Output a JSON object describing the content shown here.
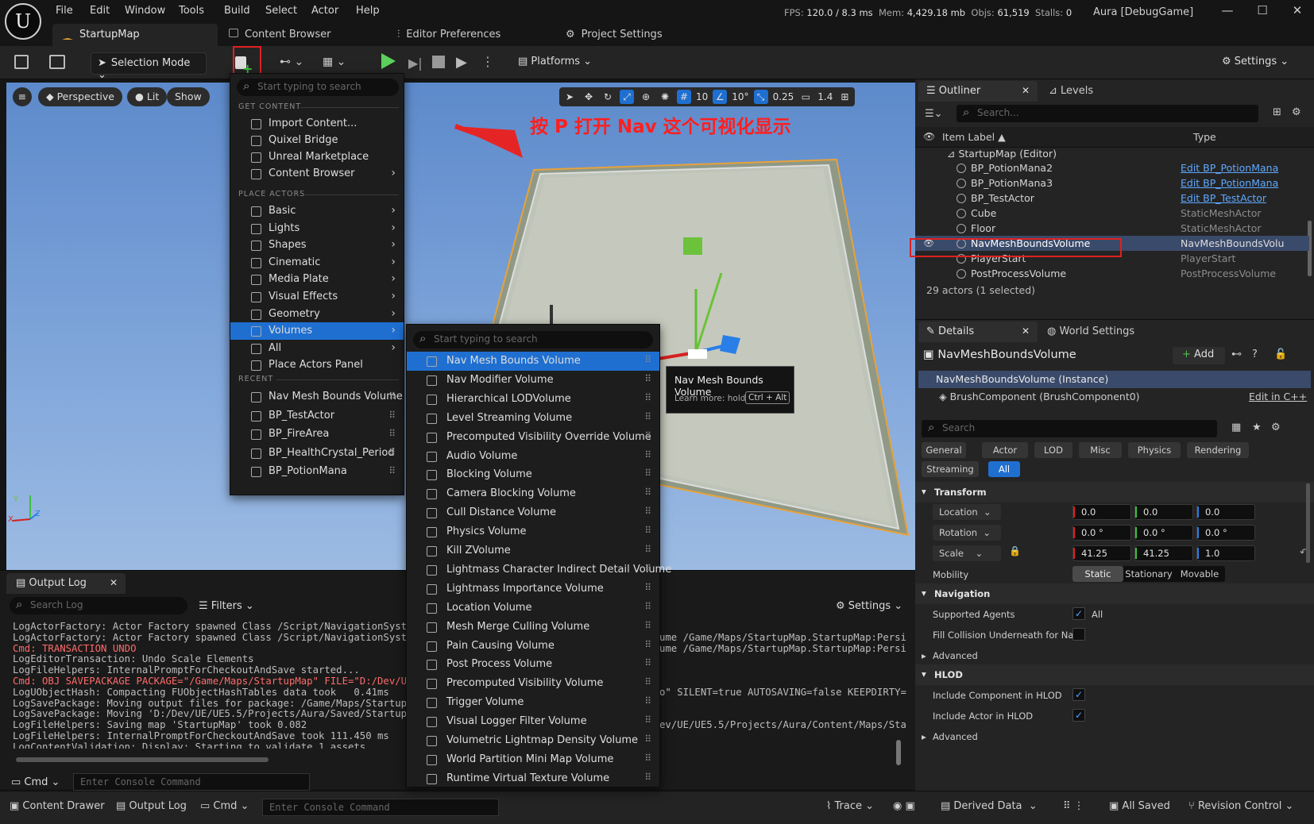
{
  "app": {
    "logo": "U",
    "menus": [
      "File",
      "Edit",
      "Window",
      "Tools",
      "Build",
      "Select",
      "Actor",
      "Help"
    ],
    "stats": {
      "fps_label": "FPS:",
      "fps": "120.0",
      "ms": "/ 8.3 ms",
      "mem_label": "Mem:",
      "mem": "4,429.18 mb",
      "objs_label": "Objs:",
      "objs": "61,519",
      "stalls_label": "Stalls:",
      "stalls": "0"
    },
    "project": "Aura [DebugGame]",
    "window_buttons": [
      "—",
      "☐",
      "✕"
    ]
  },
  "tabs": {
    "active": "StartupMap",
    "others": [
      "Content Browser",
      "Editor Preferences",
      "Project Settings"
    ]
  },
  "toolbar": {
    "selection_mode": "Selection Mode",
    "platforms": "Platforms",
    "settings": "Settings"
  },
  "viewport": {
    "buttons": [
      "Perspective",
      "Lit",
      "Show"
    ],
    "grid_value": "10",
    "angle_value": "10°",
    "scale_value": "0.25",
    "camera_speed": "1.4",
    "annotation": "按 P 打开 Nav 这个可视化显示",
    "axis_labels": {
      "x": "X",
      "y": "Y",
      "z": "Z"
    }
  },
  "place_menu": {
    "search_placeholder": "Start typing to search",
    "get_content_header": "GET CONTENT",
    "get_content": [
      "Import Content...",
      "Quixel Bridge",
      "Unreal Marketplace",
      "Content Browser"
    ],
    "place_actors_header": "PLACE ACTORS",
    "place_actors": [
      "Basic",
      "Lights",
      "Shapes",
      "Cinematic",
      "Media Plate",
      "Visual Effects",
      "Geometry",
      "Volumes",
      "All",
      "Place Actors Panel"
    ],
    "recent_header": "RECENT",
    "recent": [
      "Nav Mesh Bounds Volume",
      "BP_TestActor",
      "BP_FireArea",
      "BP_HealthCrystal_Period",
      "BP_PotionMana"
    ]
  },
  "volumes_menu": {
    "search_placeholder": "Start typing to search",
    "items": [
      "Nav Mesh Bounds Volume",
      "Nav Modifier Volume",
      "Hierarchical LODVolume",
      "Level Streaming Volume",
      "Precomputed Visibility Override Volume",
      "Audio Volume",
      "Blocking Volume",
      "Camera Blocking Volume",
      "Cull Distance Volume",
      "Physics Volume",
      "Kill ZVolume",
      "Lightmass Character Indirect Detail Volume",
      "Lightmass Importance Volume",
      "Location Volume",
      "Mesh Merge Culling Volume",
      "Pain Causing Volume",
      "Post Process Volume",
      "Precomputed Visibility Volume",
      "Trigger Volume",
      "Visual Logger Filter Volume",
      "Volumetric Lightmap Density Volume",
      "World Partition Mini Map Volume",
      "Runtime Virtual Texture Volume"
    ]
  },
  "tooltip": {
    "title": "Nav Mesh Bounds Volume",
    "learn": "Learn more: hold",
    "keys": "Ctrl + Alt"
  },
  "outliner": {
    "tab": "Outliner",
    "tab2": "Levels",
    "search_placeholder": "Search...",
    "col_label": "Item Label ▲",
    "col_type": "Type",
    "root": "StartupMap (Editor)",
    "rows": [
      {
        "label": "BP_PotionMana2",
        "type": "Edit BP_PotionMana",
        "link": true
      },
      {
        "label": "BP_PotionMana3",
        "type": "Edit BP_PotionMana",
        "link": true
      },
      {
        "label": "BP_TestActor",
        "type": "Edit BP_TestActor",
        "link": true
      },
      {
        "label": "Cube",
        "type": "StaticMeshActor",
        "link": false
      },
      {
        "label": "Floor",
        "type": "StaticMeshActor",
        "link": false
      },
      {
        "label": "NavMeshBoundsVolume",
        "type": "NavMeshBoundsVolu",
        "link": false
      },
      {
        "label": "PlayerStart",
        "type": "PlayerStart",
        "link": false
      },
      {
        "label": "PostProcessVolume",
        "type": "PostProcessVolume",
        "link": false
      }
    ],
    "count": "29 actors (1 selected)"
  },
  "details": {
    "tab": "Details",
    "tab2": "World Settings",
    "title": "NavMeshBoundsVolume",
    "add": "Add",
    "instance": "NavMeshBoundsVolume (Instance)",
    "component": "BrushComponent (BrushComponent0)",
    "edit_cpp": "Edit in C++",
    "search_placeholder": "Search",
    "filters": [
      "General",
      "Actor",
      "LOD",
      "Misc",
      "Physics",
      "Rendering",
      "Streaming",
      "All"
    ],
    "transform": {
      "header": "Transform",
      "location_label": "Location",
      "location": [
        "0.0",
        "0.0",
        "0.0"
      ],
      "rotation_label": "Rotation",
      "rotation": [
        "0.0 °",
        "0.0 °",
        "0.0 °"
      ],
      "scale_label": "Scale",
      "scale": [
        "41.25",
        "41.25",
        "1.0"
      ],
      "mobility_label": "Mobility",
      "mobility": [
        "Static",
        "Stationary",
        "Movable"
      ]
    },
    "navigation": {
      "header": "Navigation",
      "supported_agents": "Supported Agents",
      "all": "All",
      "fill_collision": "Fill Collision Underneath for Na...",
      "advanced": "Advanced"
    },
    "hlod": {
      "header": "HLOD",
      "include_component": "Include Component in HLOD",
      "include_actor": "Include Actor in HLOD",
      "advanced": "Advanced"
    }
  },
  "output_log": {
    "tab": "Output Log",
    "search_placeholder": "Search Log",
    "filters": "Filters",
    "settings": "Settings",
    "cmd": "Cmd",
    "console_placeholder": "Enter Console Command",
    "lines": [
      {
        "t": "LogActorFactory: Actor Factory spawned Class /Script/NavigationSystem.N",
        "cmd": false
      },
      {
        "t": "LogActorFactory: Actor Factory spawned Class /Script/NavigationSystem.N",
        "cmd": false
      },
      {
        "t": "Cmd: TRANSACTION UNDO",
        "cmd": true
      },
      {
        "t": "LogEditorTransaction: Undo Scale Elements",
        "cmd": false
      },
      {
        "t": "LogFileHelpers: InternalPromptForCheckoutAndSave started...",
        "cmd": false
      },
      {
        "t": "Cmd: OBJ SAVEPACKAGE PACKAGE=\"/Game/Maps/StartupMap\" FILE=\"D:/Dev/UE/UE",
        "cmd": true
      },
      {
        "t": "LogUObjectHash: Compacting FUObjectHashTables data took   0.41ms",
        "cmd": false
      },
      {
        "t": "LogSavePackage: Moving output files for package: /Game/Maps/StartupMap",
        "cmd": false
      },
      {
        "t": "LogSavePackage: Moving 'D:/Dev/UE/UE5.5/Projects/Aura/Saved/StartupMap",
        "cmd": false
      },
      {
        "t": "LogFileHelpers: Saving map 'StartupMap' took 0.082",
        "cmd": false
      },
      {
        "t": "LogFileHelpers: InternalPromptForCheckoutAndSave took 111.450 ms",
        "cmd": false
      },
      {
        "t": "LogContentValidation: Display: Starting to validate 1 assets",
        "cmd": false
      }
    ],
    "right_frag": [
      "ume /Game/Maps/StartupMap.StartupMap:Persi",
      "ume /Game/Maps/StartupMap.StartupMap:Persi",
      "o\" SILENT=true AUTOSAVING=false KEEPDIRTY=",
      "ev/UE/UE5.5/Projects/Aura/Content/Maps/Sta"
    ]
  },
  "statusbar": {
    "content_drawer": "Content Drawer",
    "output_log": "Output Log",
    "cmd": "Cmd",
    "console_placeholder": "Enter Console Command",
    "trace": "Trace",
    "derived_data": "Derived Data",
    "all_saved": "All Saved",
    "revision_control": "Revision Control"
  }
}
